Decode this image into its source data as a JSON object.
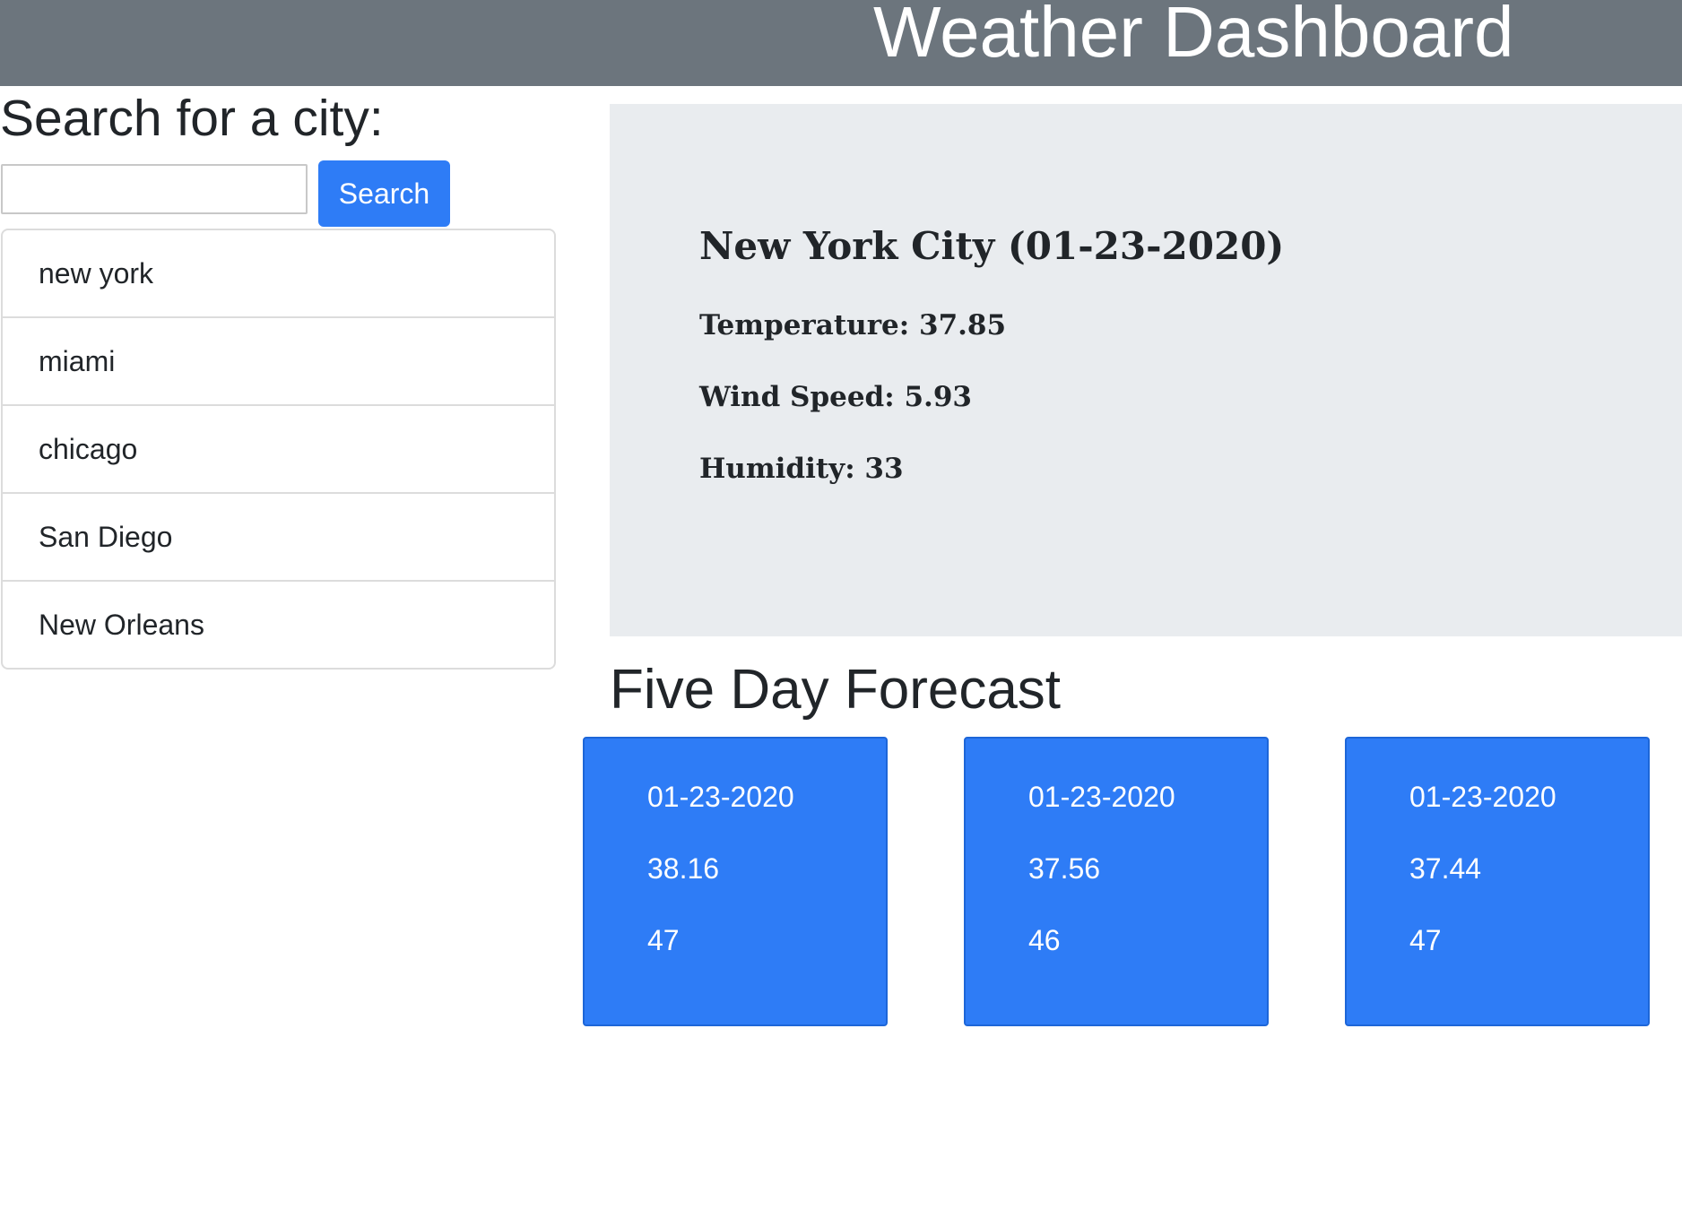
{
  "header": {
    "title": "Weather Dashboard"
  },
  "sidebar": {
    "heading": "Search for a city:",
    "search_value": "",
    "search_placeholder": "",
    "search_button_label": "Search",
    "cities": [
      {
        "label": "new york"
      },
      {
        "label": "miami"
      },
      {
        "label": "chicago"
      },
      {
        "label": "San Diego"
      },
      {
        "label": "New Orleans"
      }
    ]
  },
  "current": {
    "city": "New York City",
    "date": "(01-23-2020)",
    "title": "New York City  (01-23-2020)",
    "temperature": "Temperature: 37.85",
    "wind_speed": "Wind Speed: 5.93",
    "humidity": "Humidity: 33",
    "panel_color": "#e9ecef"
  },
  "forecast": {
    "heading": "Five Day Forecast",
    "card_color": "#2e7cf6",
    "cards": [
      {
        "date": "01-23-2020",
        "temp": "38.16",
        "humidity": "47"
      },
      {
        "date": "01-23-2020",
        "temp": "37.56",
        "humidity": "46"
      },
      {
        "date": "01-23-2020",
        "temp": "37.44",
        "humidity": "47"
      }
    ]
  },
  "colors": {
    "header": "#6c757d",
    "accent": "#2e7cf6"
  }
}
